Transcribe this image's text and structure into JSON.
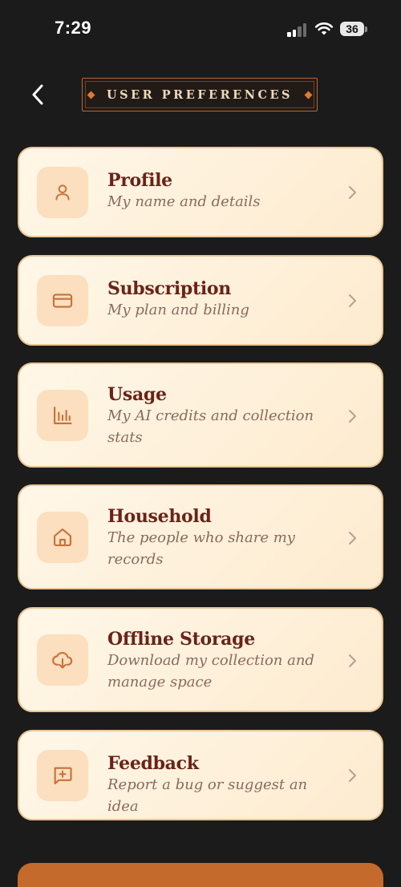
{
  "status_bar": {
    "time": "7:29",
    "battery": "36"
  },
  "header": {
    "title": "USER PREFERENCES"
  },
  "menu": [
    {
      "id": "profile",
      "title": "Profile",
      "subtitle": "My name and details",
      "icon": "user-icon"
    },
    {
      "id": "subscription",
      "title": "Subscription",
      "subtitle": "My plan and billing",
      "icon": "credit-card-icon"
    },
    {
      "id": "usage",
      "title": "Usage",
      "subtitle": "My AI credits and collection stats",
      "icon": "bar-chart-icon"
    },
    {
      "id": "household",
      "title": "Household",
      "subtitle": "The people who share my records",
      "icon": "home-icon"
    },
    {
      "id": "offline-storage",
      "title": "Offline Storage",
      "subtitle": "Download my collection and manage space",
      "icon": "cloud-download-icon"
    },
    {
      "id": "feedback",
      "title": "Feedback",
      "subtitle": "Report a bug or suggest an idea",
      "icon": "message-plus-icon"
    }
  ],
  "colors": {
    "background": "#1c1b1b",
    "card_background": "#fff3df",
    "card_border": "#e9c493",
    "title_text": "#6a2318",
    "subtitle_text": "#8a6a5e",
    "accent": "#e07a2e",
    "icon_stroke": "#c9703a"
  }
}
